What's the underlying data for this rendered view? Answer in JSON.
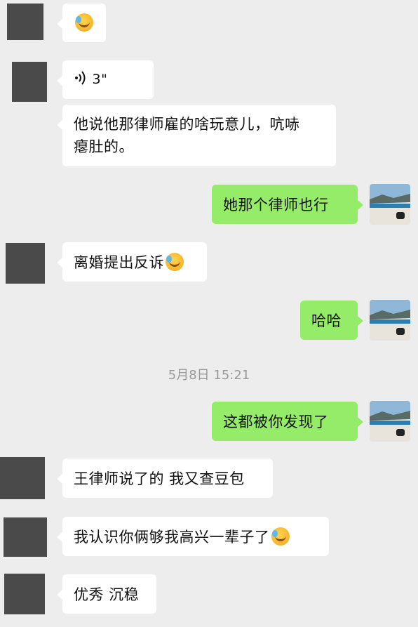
{
  "messages": [
    {
      "side": "left",
      "type": "emoji"
    },
    {
      "side": "left",
      "type": "voice",
      "duration": "3\""
    },
    {
      "side": "left",
      "type": "text",
      "text_line1": "他说他那律师雇的啥玩意儿，吭哧",
      "text_line2": "瘪肚的。"
    },
    {
      "side": "right",
      "type": "text",
      "text": "她那个律师也行"
    },
    {
      "side": "left",
      "type": "text",
      "text": "离婚提出反诉",
      "emoji": "face-with-tears-of-joy"
    },
    {
      "side": "right",
      "type": "text",
      "text": "哈哈"
    },
    {
      "side": "right",
      "type": "text",
      "text": "这都被你发现了"
    },
    {
      "side": "left",
      "type": "text",
      "text": "王律师说了的 我又查豆包"
    },
    {
      "side": "left",
      "type": "text",
      "text": "我认识你俩够我高兴一辈子了",
      "emoji": "face-with-tears-of-joy"
    },
    {
      "side": "left",
      "type": "text",
      "text": "优秀 沉稳"
    }
  ],
  "timestamp": "5月8日 15:21",
  "colors": {
    "background": "#ededed",
    "incoming": "#ffffff",
    "outgoing": "#95ec69",
    "avatar_placeholder": "#4a4a4a"
  },
  "icons": {
    "voice": "voice-wave-icon",
    "emoji": "face-with-tears-of-joy"
  }
}
